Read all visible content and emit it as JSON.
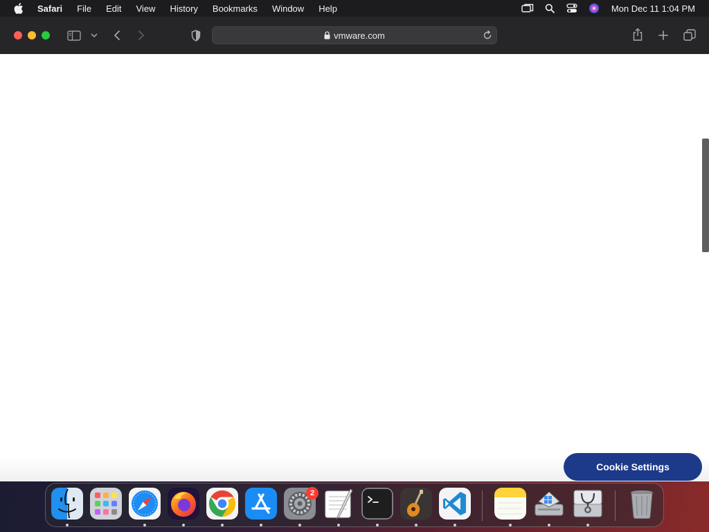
{
  "menubar": {
    "app_name": "Safari",
    "items": [
      "File",
      "Edit",
      "View",
      "History",
      "Bookmarks",
      "Window",
      "Help"
    ],
    "clock": "Mon Dec 11  1:04 PM",
    "status_icons": [
      "screen-mirroring-icon",
      "spotlight-search-icon",
      "control-center-icon",
      "siri-icon"
    ]
  },
  "browser": {
    "url": "vmware.com",
    "toolbar_icons": [
      "sidebar-toggle-icon",
      "chevron-down-icon",
      "back-icon",
      "forward-icon",
      "privacy-shield-icon",
      "lock-icon",
      "reload-icon",
      "share-icon",
      "new-tab-icon",
      "tab-overview-icon"
    ]
  },
  "page": {
    "cookie_button_label": "Cookie Settings"
  },
  "dock": {
    "apps": [
      "Finder",
      "Launchpad",
      "Safari",
      "Firefox",
      "Google Chrome",
      "App Store",
      "System Settings",
      "TextEdit",
      "Terminal",
      "GarageBand",
      "Visual Studio Code",
      "Notes",
      "Boot Camp Assistant",
      "Disk Utility",
      "Trash"
    ],
    "system_settings_badge": "2"
  },
  "colors": {
    "cookie_button": "#1d3a8a",
    "menubar_bg": "#1c1c1e",
    "toolbar_bg": "#262628"
  }
}
